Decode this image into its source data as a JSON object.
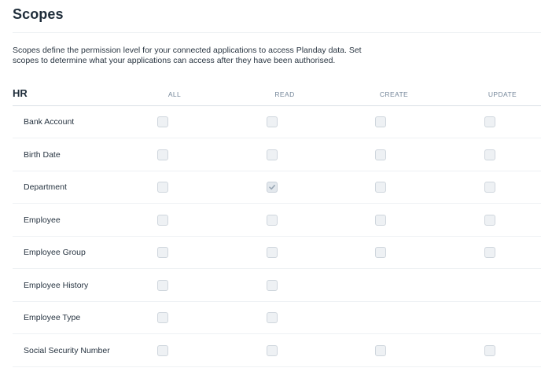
{
  "page": {
    "title": "Scopes",
    "description": "Scopes define the permission level for your connected applications to access Planday data. Set scopes to determine what your applications can access after they have been authorised."
  },
  "section": {
    "title": "HR",
    "columns": [
      "ALL",
      "READ",
      "CREATE",
      "UPDATE"
    ]
  },
  "rows": [
    {
      "label": "Bank Account",
      "all": false,
      "read": false,
      "create": false,
      "update": false
    },
    {
      "label": "Birth Date",
      "all": false,
      "read": false,
      "create": false,
      "update": false
    },
    {
      "label": "Department",
      "all": false,
      "read": true,
      "create": false,
      "update": false
    },
    {
      "label": "Employee",
      "all": false,
      "read": false,
      "create": false,
      "update": false
    },
    {
      "label": "Employee Group",
      "all": false,
      "read": false,
      "create": false,
      "update": false
    },
    {
      "label": "Employee History",
      "all": false,
      "read": false,
      "create": null,
      "update": null
    },
    {
      "label": "Employee Type",
      "all": false,
      "read": false,
      "create": null,
      "update": null
    },
    {
      "label": "Social Security Number",
      "all": false,
      "read": false,
      "create": false,
      "update": false
    }
  ]
}
